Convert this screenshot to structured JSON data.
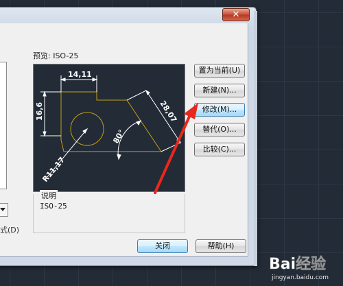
{
  "dialog": {
    "close_glyph": "✕",
    "styles_list_label": "式(D)",
    "preview_label": "预览: ISO-25",
    "description": {
      "label": "说明",
      "text": "ISO-25"
    },
    "buttons": {
      "set_current": "置为当前(U)",
      "new": "新建(N)...",
      "modify": "修改(M)...",
      "override": "替代(O)...",
      "compare": "比较(C)...",
      "close": "关闭",
      "help": "帮助(H)"
    },
    "preview_dims": {
      "width_dim": "14,11",
      "height_dim": "16,6",
      "slant_dim": "28,07",
      "angle_dim": "80°",
      "radius_dim": "R11,17"
    }
  },
  "watermark": {
    "logo": "Bai经验",
    "url": "jingyan.baidu.com"
  },
  "colors": {
    "accent": "#3c7fb1",
    "annotation_arrow": "#e8281c",
    "drawing_line": "#c8a018",
    "dimension_line": "#ffffff",
    "canvas_bg": "#222b36"
  },
  "icons": [
    "close-icon",
    "dropdown-arrow-icon",
    "red-annotation-arrow"
  ]
}
